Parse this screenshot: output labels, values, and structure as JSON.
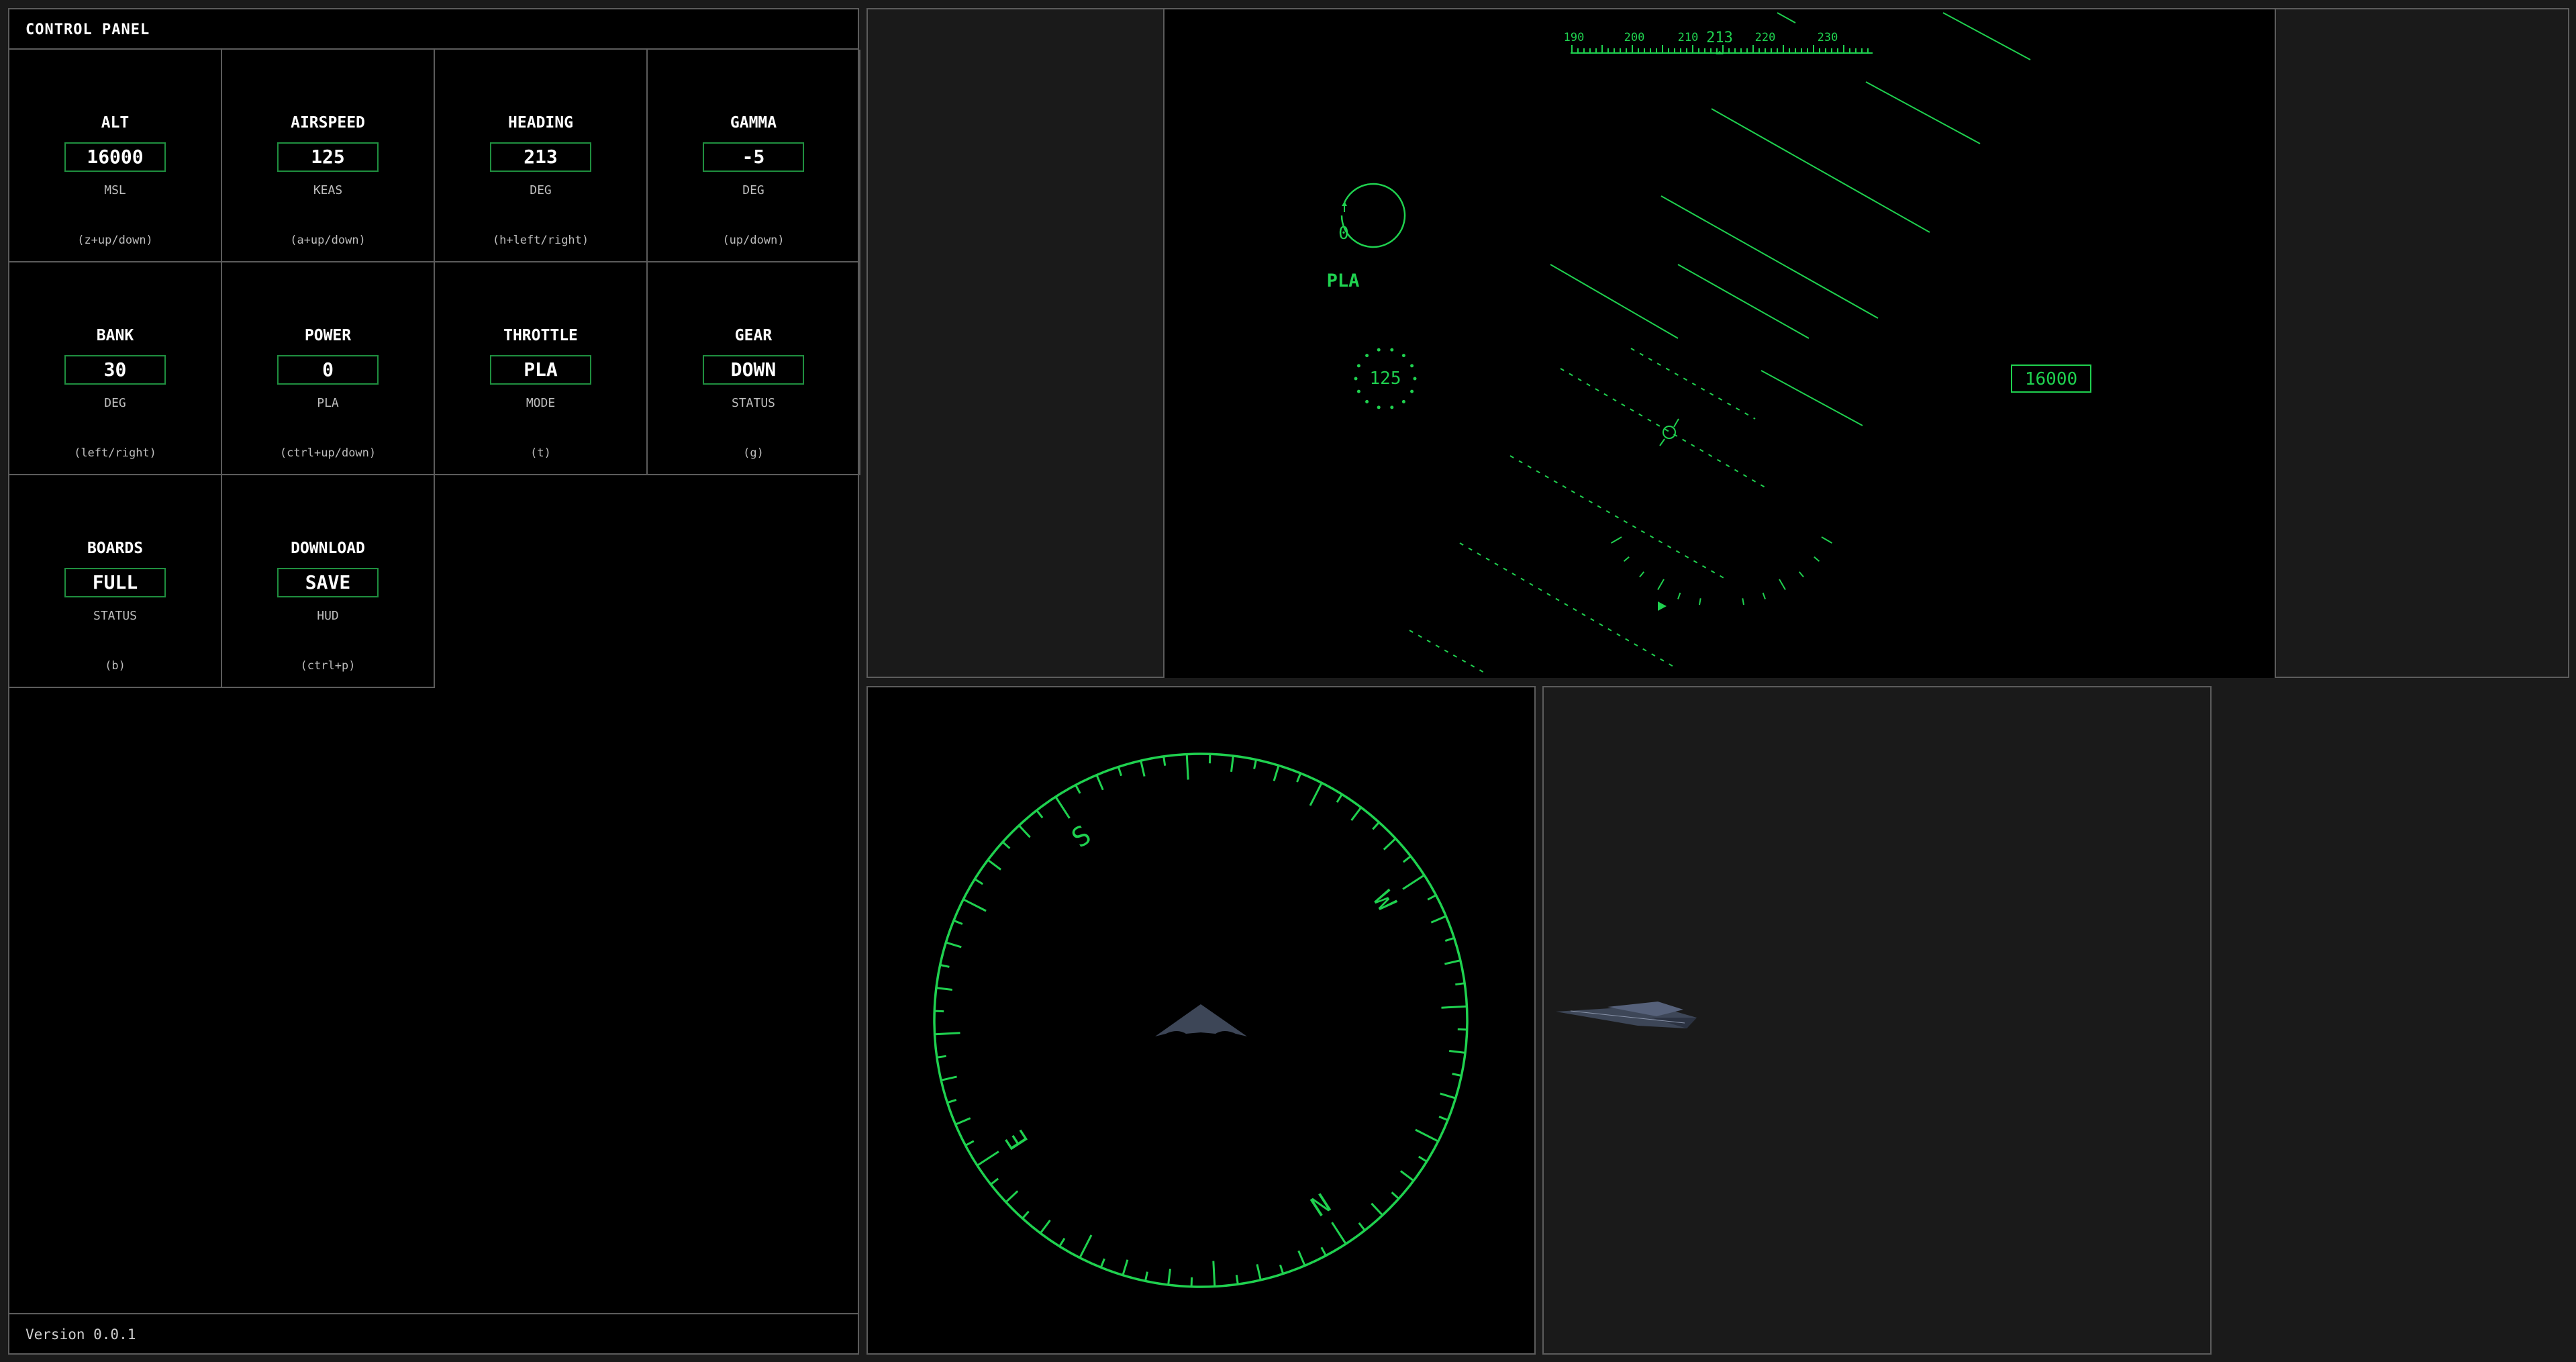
{
  "control_panel": {
    "title": "CONTROL PANEL",
    "version": "Version 0.0.1",
    "cells": [
      {
        "label": "ALT",
        "value": "16000",
        "unit": "MSL",
        "hint": "(z+up/down)"
      },
      {
        "label": "AIRSPEED",
        "value": "125",
        "unit": "KEAS",
        "hint": "(a+up/down)"
      },
      {
        "label": "HEADING",
        "value": "213",
        "unit": "DEG",
        "hint": "(h+left/right)"
      },
      {
        "label": "GAMMA",
        "value": "-5",
        "unit": "DEG",
        "hint": "(up/down)"
      },
      {
        "label": "BANK",
        "value": "30",
        "unit": "DEG",
        "hint": "(left/right)"
      },
      {
        "label": "POWER",
        "value": "0",
        "unit": "PLA",
        "hint": "(ctrl+up/down)"
      },
      {
        "label": "THROTTLE",
        "value": "PLA",
        "unit": "MODE",
        "hint": "(t)"
      },
      {
        "label": "GEAR",
        "value": "DOWN",
        "unit": "STATUS",
        "hint": "(g)"
      },
      {
        "label": "BOARDS",
        "value": "FULL",
        "unit": "STATUS",
        "hint": "(b)"
      },
      {
        "label": "DOWNLOAD",
        "value": "SAVE",
        "unit": "HUD",
        "hint": "(ctrl+p)"
      }
    ]
  },
  "hud": {
    "heading_ticks": [
      "190",
      "200",
      "210",
      "220",
      "230"
    ],
    "heading_value": "213",
    "power_value": "0",
    "power_label": "PLA",
    "airspeed_value": "125",
    "altitude_value": "16000"
  },
  "compass": {
    "cardinals": [
      "N",
      "E",
      "S",
      "W"
    ]
  },
  "colors": {
    "hud_green": "#1fd14f",
    "border_gray": "#5c5c5c",
    "aircraft": "#3d4657"
  }
}
